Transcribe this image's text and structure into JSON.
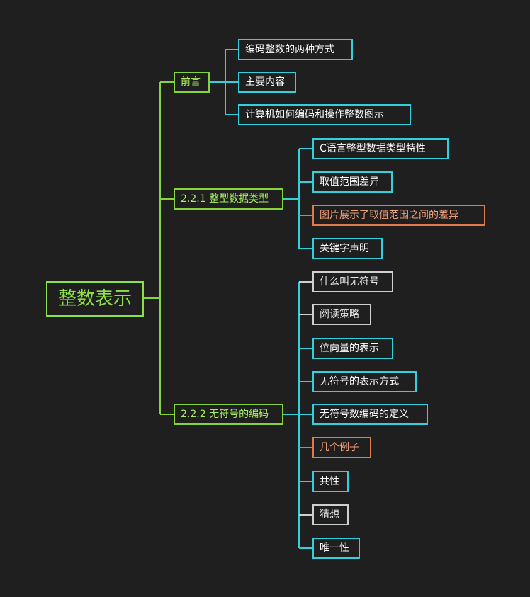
{
  "root": "整数表示",
  "branches": [
    {
      "label": "前言",
      "children": [
        {
          "label": "编码整数的两种方式",
          "color": "cyan"
        },
        {
          "label": "主要内容",
          "color": "cyan"
        },
        {
          "label": "计算机如何编码和操作整数图示",
          "color": "cyan"
        }
      ]
    },
    {
      "label": "2.2.1 整型数据类型",
      "children": [
        {
          "label": "C语言整型数据类型特性",
          "color": "cyan"
        },
        {
          "label": "取值范围差异",
          "color": "cyan"
        },
        {
          "label": "图片展示了取值范围之间的差异",
          "color": "orange"
        },
        {
          "label": "关键字声明",
          "color": "cyan"
        }
      ]
    },
    {
      "label": "2.2.2 无符号的编码",
      "children": [
        {
          "label": "什么叫无符号",
          "color": "white"
        },
        {
          "label": "阅读策略",
          "color": "white"
        },
        {
          "label": "位向量的表示",
          "color": "cyan"
        },
        {
          "label": "无符号的表示方式",
          "color": "cyan"
        },
        {
          "label": "无符号数编码的定义",
          "color": "cyan"
        },
        {
          "label": "几个例子",
          "color": "orange"
        },
        {
          "label": "共性",
          "color": "cyan"
        },
        {
          "label": "猜想",
          "color": "white"
        },
        {
          "label": "唯一性",
          "color": "cyan"
        }
      ]
    }
  ],
  "colors": {
    "background": "#1f1f1f",
    "green_line": "#86d43c",
    "cyan_line": "#33d0dc"
  }
}
